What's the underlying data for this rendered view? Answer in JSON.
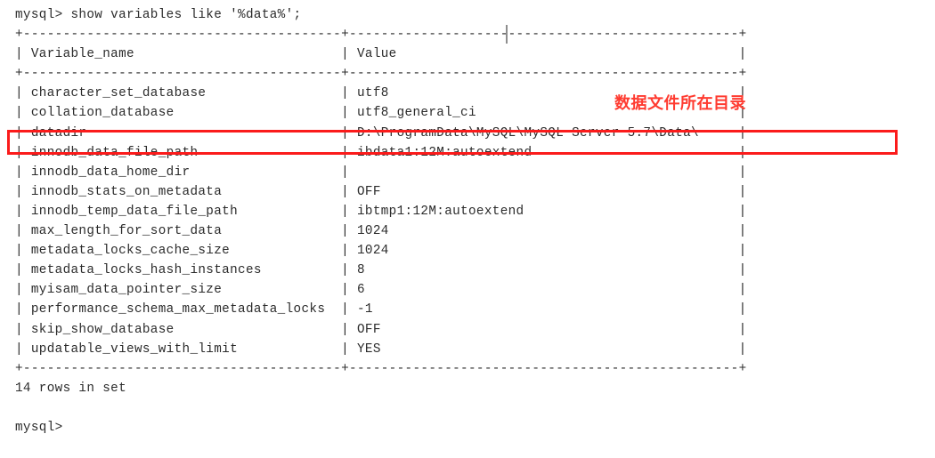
{
  "terminal": {
    "prompt": "mysql>",
    "command": "show variables like '%data%';",
    "command_line": "mysql> show variables like '%data%';",
    "border_top": "+----------------------------------------+-------------------------------------------------+",
    "border_header": "+----------------------------------------+-------------------------------------------------+",
    "border_bottom": "+----------------------------------------+-------------------------------------------------+",
    "header_row": "| Variable_name                          | Value                                           |",
    "columns": [
      "Variable_name",
      "Value"
    ],
    "rows": [
      {
        "name": "character_set_database",
        "value": "utf8"
      },
      {
        "name": "collation_database",
        "value": "utf8_general_ci"
      },
      {
        "name": "datadir",
        "value": "D:\\ProgramData\\MySQL\\MySQL Server 5.7\\Data\\"
      },
      {
        "name": "innodb_data_file_path",
        "value": "ibdata1:12M:autoextend"
      },
      {
        "name": "innodb_data_home_dir",
        "value": ""
      },
      {
        "name": "innodb_stats_on_metadata",
        "value": "OFF"
      },
      {
        "name": "innodb_temp_data_file_path",
        "value": "ibtmp1:12M:autoextend"
      },
      {
        "name": "max_length_for_sort_data",
        "value": "1024"
      },
      {
        "name": "metadata_locks_cache_size",
        "value": "1024"
      },
      {
        "name": "metadata_locks_hash_instances",
        "value": "8"
      },
      {
        "name": "myisam_data_pointer_size",
        "value": "6"
      },
      {
        "name": "performance_schema_max_metadata_locks",
        "value": "-1"
      },
      {
        "name": "skip_show_database",
        "value": "OFF"
      },
      {
        "name": "updatable_views_with_limit",
        "value": "YES"
      }
    ],
    "result_status": "14 rows in set",
    "trailing_prompt": "mysql>",
    "text_color": "#2b2b2b",
    "background_color": "#ffffff"
  },
  "annotations": {
    "note_text": "数据文件所在目录",
    "note_color": "#ff3b30",
    "highlight_target": "datadir",
    "highlight_color": "#fb1b1b"
  }
}
